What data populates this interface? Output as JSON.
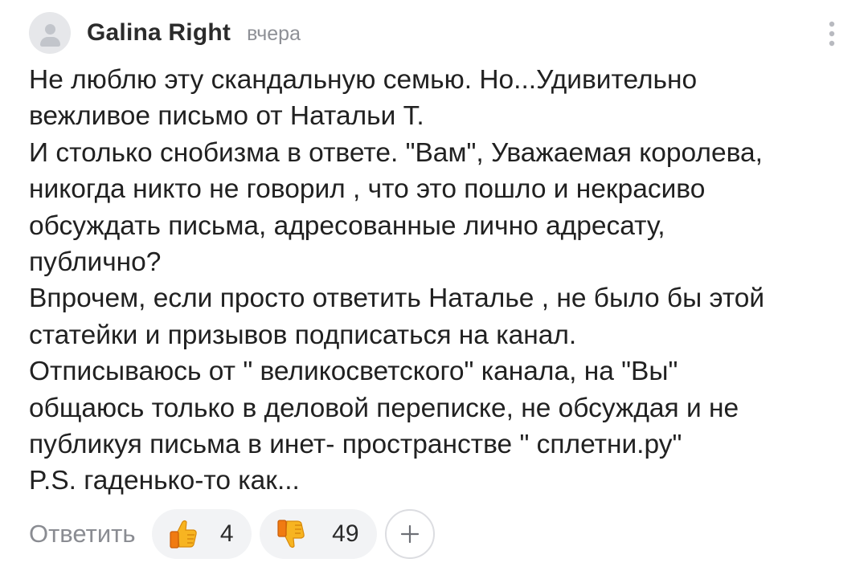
{
  "comment": {
    "author": "Galina Right",
    "time": "вчера",
    "lines": [
      "Не люблю эту скандальную семью. Но...Удивительно",
      "вежливое письмо от Натальи Т.",
      "И столько снобизма в ответе. \"Вам\", Уважаемая королева,",
      "никогда никто не говорил , что это пошло и некрасиво",
      "обсуждать письма, адресованные лично адресату,",
      "публично?",
      "Впрочем, если просто ответить Наталье , не было бы этой",
      "статейки и призывов подписаться на канал.",
      "Отписываюсь от \" великосветского\" канала, на \"Вы\"",
      "общаюсь только в деловой переписке, не обсуждая и не",
      "публикуя письма в инет- пространстве \" сплетни.ру\"",
      "P.S. гаденько-то как..."
    ]
  },
  "actions": {
    "reply_label": "Ответить",
    "like": {
      "icon": "thumbs-up-emoji",
      "count": "4"
    },
    "dislike": {
      "icon": "thumbs-down-emoji",
      "count": "49"
    },
    "add_reaction_icon": "plus-icon",
    "more_icon": "vertical-dots-icon"
  },
  "colors": {
    "reaction_bg": "#f2f3f5",
    "muted_text": "#8a8c92",
    "emoji_yellow": "#f7b421",
    "emoji_orange": "#f07b12"
  }
}
